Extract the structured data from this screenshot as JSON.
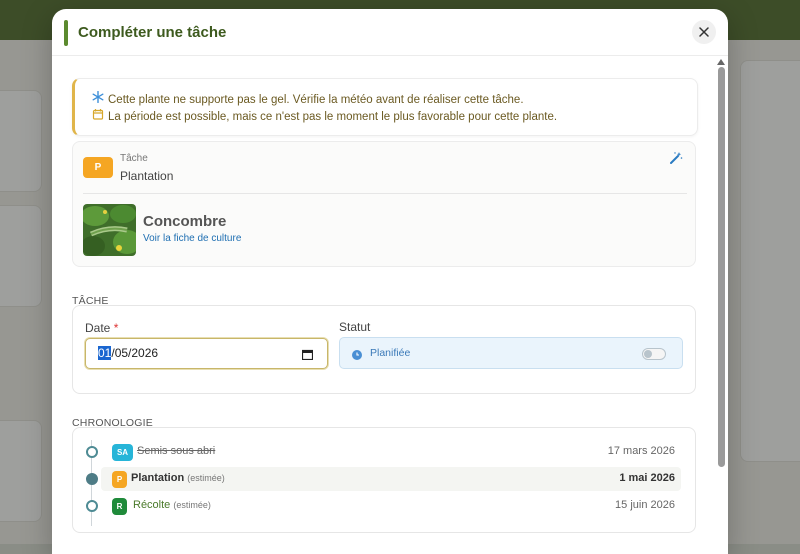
{
  "modal": {
    "title": "Compléter une tâche",
    "close_icon": "close-icon"
  },
  "alerts": [
    {
      "icon": "snowflake-icon",
      "text": "Cette plante ne supporte pas le gel. Vérifie la météo avant de réaliser cette tâche."
    },
    {
      "icon": "calendar-icon",
      "text": "La période est possible, mais ce n'est pas le moment le plus favorable pour cette plante."
    }
  ],
  "task": {
    "badge": "P",
    "label": "Tâche",
    "name": "Plantation",
    "edit_icon": "magic-wand-icon"
  },
  "plant": {
    "name": "Concombre",
    "link": "Voir la fiche de culture"
  },
  "section_task": "TÂCHE",
  "form": {
    "date_label": "Date",
    "required_mark": "*",
    "date_selected": "01",
    "date_rest": "/05/2026",
    "status_label": "Statut",
    "status_value": "Planifiée"
  },
  "section_chronology": "CHRONOLOGIE",
  "timeline": [
    {
      "badge": "SA",
      "name": "Semis sous abri",
      "estimated": "",
      "date": "17 mars 2026",
      "done": true
    },
    {
      "badge": "P",
      "name": "Plantation",
      "estimated": "(estimée)",
      "date": "1 mai 2026",
      "current": true
    },
    {
      "badge": "R",
      "name": "Récolte",
      "estimated": "(estimée)",
      "date": "15 juin 2026"
    }
  ],
  "colors": {
    "accent": "#5b8a2e",
    "badge_p": "#f5a623",
    "badge_sa": "#27b5d8",
    "badge_r": "#1f8a3a",
    "link": "#1f6fb2",
    "alert_border": "#e0b54a"
  }
}
